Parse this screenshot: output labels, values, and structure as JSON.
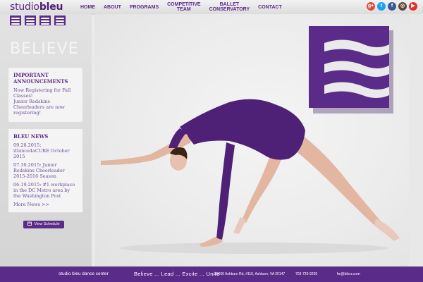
{
  "brand": {
    "studio": "studio",
    "bleu": "bleu"
  },
  "nav": [
    {
      "line1": "HOME",
      "line2": ""
    },
    {
      "line1": "ABOUT",
      "line2": ""
    },
    {
      "line1": "PROGRAMS",
      "line2": ""
    },
    {
      "line1": "COMPETITIVE",
      "line2": "TEAM"
    },
    {
      "line1": "BALLET",
      "line2": "CONSERVATORY"
    },
    {
      "line1": "CONTACT",
      "line2": ""
    }
  ],
  "social": [
    {
      "icon": "google-plus-icon",
      "glyph": "g+",
      "color": "#dd4b39"
    },
    {
      "icon": "twitter-icon",
      "glyph": "t",
      "color": "#1da1f2"
    },
    {
      "icon": "facebook-icon",
      "glyph": "f",
      "color": "#3b5998"
    },
    {
      "icon": "instagram-icon",
      "glyph": "◎",
      "color": "#5a4a3a"
    },
    {
      "icon": "youtube-icon",
      "glyph": "▶",
      "color": "#e52d27"
    }
  ],
  "sidebar": {
    "tagline": "BELIEVE",
    "announcements": {
      "title": "IMPORTANT ANNOUNCEMENTS",
      "lines": [
        "Now Registering for Fall Classes!",
        "Junior Redskins Cheerleaders are now registering!"
      ]
    },
    "news": {
      "title": "BLEU NEWS",
      "items": [
        "09.28.2015: iDance4aCURE October 2015",
        "07.30.2015: Junior Redskins Cheerleader 2015-2016 Season",
        "06.19.2015: #1 workplace in the DC Metro area by the Washington Post"
      ],
      "more": "More News >>"
    },
    "schedule_button": "View Schedule"
  },
  "footer": {
    "name": "studio bleu dance center",
    "motto": "Believe ... Lead ... Excite ... Unite",
    "address": "20660 Ashburn Rd, #110, Ashburn, VA 20147",
    "phone": "703-729-9295",
    "email": "hr@bleu.com"
  },
  "colors": {
    "brand_purple": "#5b2b89",
    "footer": "#5b2b89"
  }
}
